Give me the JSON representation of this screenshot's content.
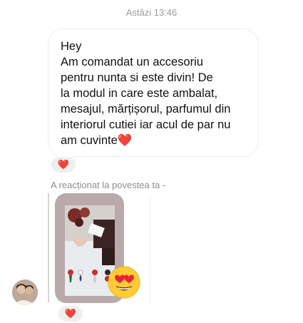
{
  "chat": {
    "timestamp": "Astăzi 13:46",
    "message": {
      "lines": [
        "Hey",
        "Am comandat un accesoriu",
        "pentru nunta si este divin! De",
        "la modul in care este ambalat,",
        "mesajul, mărțișorul, parfumul din",
        "interiorul cutiei iar acul de par nu",
        "am cuvinte"
      ],
      "trailing_emoji": "❤️",
      "reaction": "❤️"
    },
    "story_reply": {
      "note": "A reacționat la povestea ta -",
      "sticker_icon": "heart-eyes-emoji-icon",
      "reaction": "❤️"
    },
    "colors": {
      "reaction_heart": "#e0243a",
      "bubble_border": "#ececec",
      "meta_text": "#9a9a9a"
    }
  }
}
